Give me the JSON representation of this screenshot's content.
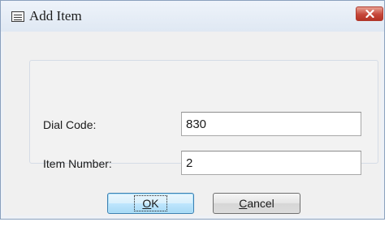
{
  "dialog": {
    "title": "Add Item"
  },
  "form": {
    "dial_code_label": "Dial Code:",
    "dial_code_value": "830",
    "item_number_label": "Item Number:",
    "item_number_value": "2"
  },
  "buttons": {
    "ok_mnemonic": "O",
    "ok_rest": "K",
    "cancel_mnemonic": "C",
    "cancel_rest": "ancel"
  }
}
